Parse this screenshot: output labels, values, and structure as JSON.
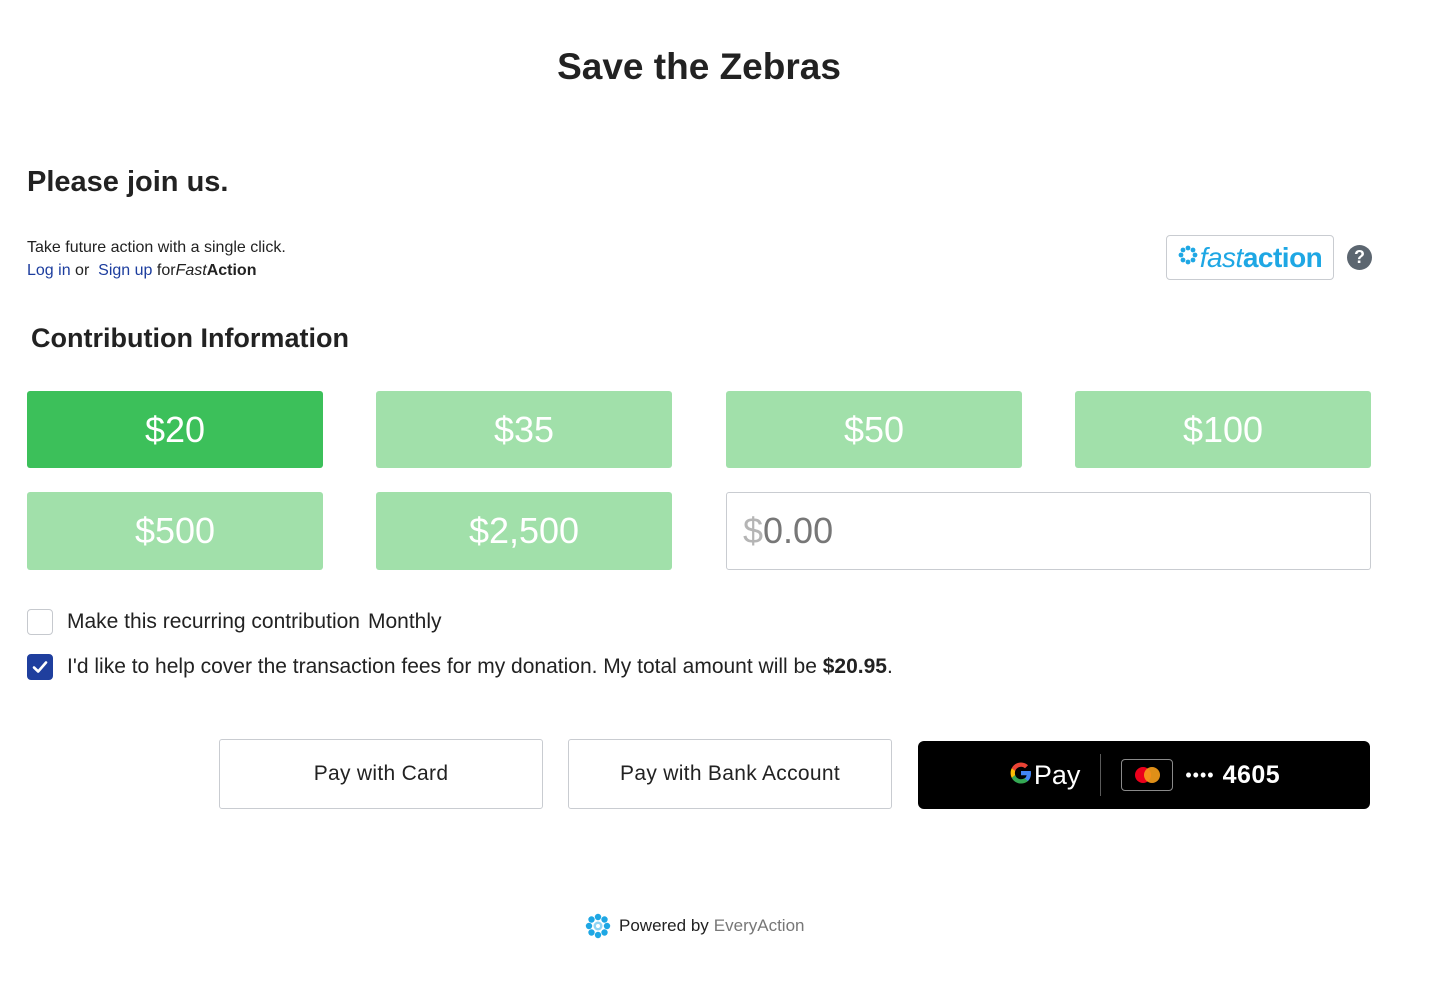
{
  "page": {
    "title": "Save the Zebras"
  },
  "join": {
    "heading": "Please join us.",
    "blurb": "Take future action with a single click.",
    "login_label": "Log in",
    "or_text": "or",
    "signup_label": "Sign up",
    "for_text": "for",
    "brand_fast": "Fast",
    "brand_action": "Action",
    "logo_fast": "fast",
    "logo_action": "action",
    "help_symbol": "?"
  },
  "contribution": {
    "heading": "Contribution Information",
    "amounts": [
      {
        "label": "$20",
        "selected": true
      },
      {
        "label": "$35",
        "selected": false
      },
      {
        "label": "$50",
        "selected": false
      },
      {
        "label": "$100",
        "selected": false
      },
      {
        "label": "$500",
        "selected": false
      },
      {
        "label": "$2,500",
        "selected": false
      }
    ],
    "other_currency": "$",
    "other_placeholder": "0.00"
  },
  "options": {
    "recurring_label": "Make this recurring contribution",
    "recurring_frequency": "Monthly",
    "recurring_checked": false,
    "cover_fees_label": "I'd like to help cover the transaction fees for my donation. My total amount will be",
    "cover_fees_total": "$20.95",
    "cover_fees_period": ".",
    "cover_fees_checked": true
  },
  "payment": {
    "card_label": "Pay with Card",
    "bank_label": "Pay with Bank Account",
    "gpay_g": "G",
    "gpay_pay": "Pay",
    "card_dots": "••••",
    "card_last4": "4605"
  },
  "footer": {
    "powered_by": "Powered by",
    "brand": "EveryAction"
  },
  "colors": {
    "selected_amount": "#3cc05a",
    "unselected_amount": "#a1e0aa",
    "link": "#1c3d9e",
    "fastaction_blue": "#1ea7e4",
    "checkbox_checked": "#1f3f9e"
  },
  "icons": {
    "fastaction_logo": "gear-flower-icon",
    "help": "question-circle-icon",
    "checkmark": "checkmark-icon",
    "gpay": "google-g-icon",
    "card": "mastercard-icon",
    "footer_logo": "gear-flower-icon"
  }
}
